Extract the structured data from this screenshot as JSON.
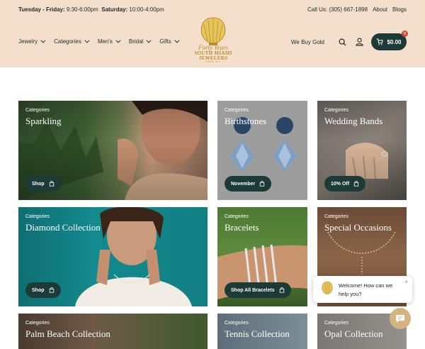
{
  "topbar": {
    "hours_weekday_label": "Tuesday - Friday:",
    "hours_weekday": "9:30-6:00pm",
    "hours_saturday_label": "Saturday:",
    "hours_saturday": "10:00-4:00pm",
    "call": "Call Us: (305) 667-1898",
    "about": "About",
    "blogs": "Blogs"
  },
  "nav": {
    "items": [
      {
        "label": "Jewelry"
      },
      {
        "label": "Categories"
      },
      {
        "label": "Men's"
      },
      {
        "label": "Bridal"
      },
      {
        "label": "Gifts"
      }
    ],
    "buy_gold": "We Buy Gold",
    "cart_total": "$0.00",
    "cart_count": "0"
  },
  "logo": {
    "line1": "Forty Years",
    "line2": "SOUTH MIAMI",
    "line3": "JEWELERS",
    "line4": "SINCE 1977"
  },
  "cards": [
    {
      "category": "Categories",
      "title": "Sparkling",
      "button": "Shop"
    },
    {
      "category": "Categories",
      "title": "Birthstones",
      "button": "November"
    },
    {
      "category": "Categories",
      "title": "Wedding Bands",
      "button": "10% Off"
    },
    {
      "category": "Categories",
      "title": "Diamond Collection",
      "button": "Shop"
    },
    {
      "category": "Categories",
      "title": "Bracelets",
      "button": "Shop All Bracelets"
    },
    {
      "category": "Categories",
      "title": "Special Occasions",
      "button": ""
    },
    {
      "category": "Categories",
      "title": "Palm Beach Collection",
      "button": ""
    },
    {
      "category": "Categories",
      "title": "Tennis Collection",
      "button": ""
    },
    {
      "category": "Categories",
      "title": "Opal Collection",
      "button": ""
    }
  ],
  "chat": {
    "message": "Welcome! How can we help you?",
    "close": "×"
  },
  "colors": {
    "header_bg": "#f3dfcb",
    "accent_dark": "#1c3a37",
    "gold": "#b88d2a",
    "badge": "#e0433b"
  }
}
